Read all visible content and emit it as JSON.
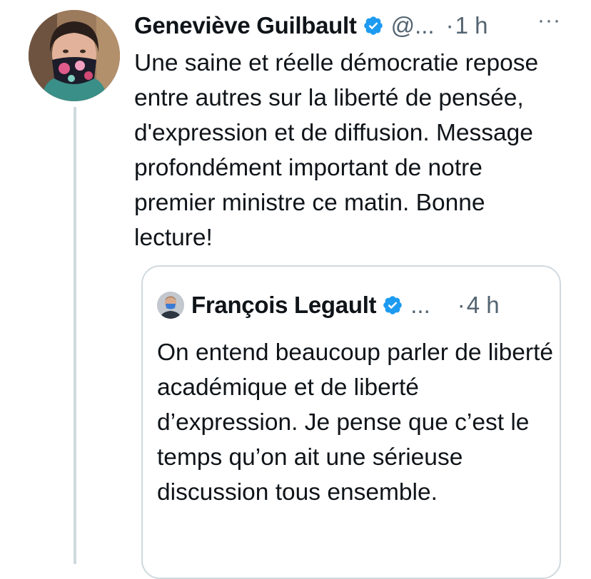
{
  "tweet": {
    "author_name": "Geneviève Guilbault",
    "handle": "@...",
    "separator": "·",
    "time": "1 h",
    "more": "···",
    "text": "Une saine et réelle démocratie repose entre autres sur la liberté de pensée, d'expression et de diffusion. Message profondément important de notre premier ministre ce matin. Bonne lecture!",
    "verified_icon": "verified-badge-icon",
    "avatar_desc": "avatar",
    "colors": {
      "accent": "#1d9bf0",
      "text": "#0f1419",
      "muted": "#536471",
      "border": "#cfd9de"
    }
  },
  "quoted_tweet": {
    "author_name": "François Legault",
    "handle": "...",
    "separator": "·",
    "time": "4 h",
    "text": "On entend beaucoup parler de liberté académique et de liberté d’expression. Je pense que c’est le temps qu’on ait une sérieuse discussion tous ensemble.",
    "verified_icon": "verified-badge-icon"
  }
}
